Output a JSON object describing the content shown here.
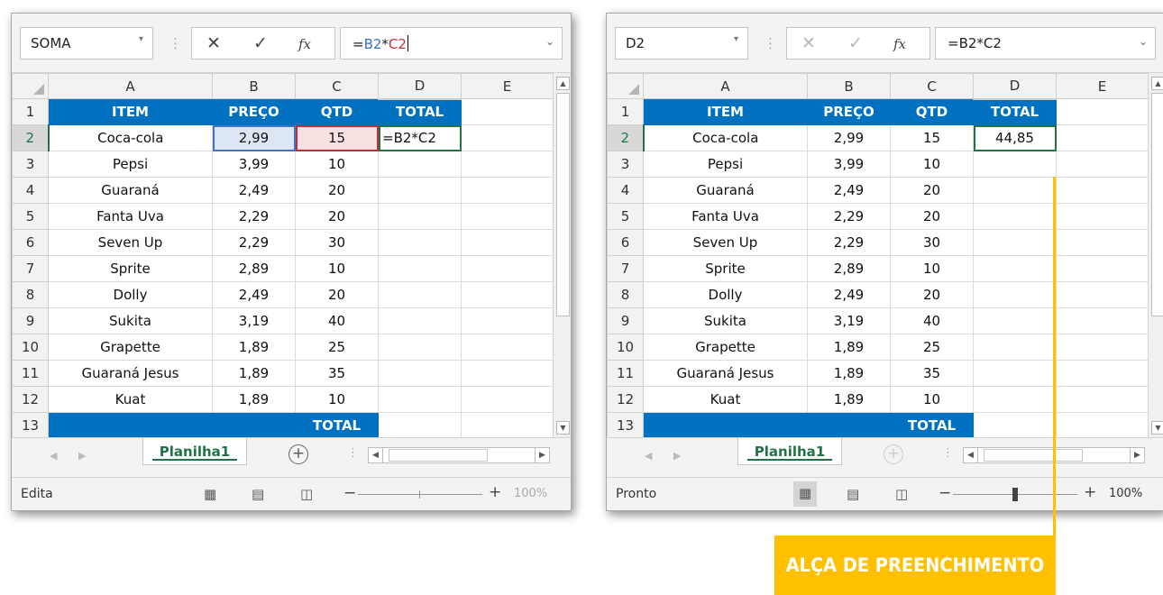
{
  "left": {
    "namebox": "SOMA",
    "formula_parts": [
      "=",
      "B2",
      "*",
      "C2"
    ],
    "sheet_tab": "Planilha1",
    "status_mode": "Edita",
    "zoom": "100%",
    "active_cell_text": "=B2*C2"
  },
  "right": {
    "namebox": "D2",
    "formula": "=B2*C2",
    "sheet_tab": "Planilha1",
    "status_mode": "Pronto",
    "zoom": "100%",
    "d2_value": "44,85"
  },
  "columns": [
    "A",
    "B",
    "C",
    "D",
    "E"
  ],
  "row_numbers": [
    "1",
    "2",
    "3",
    "4",
    "5",
    "6",
    "7",
    "8",
    "9",
    "10",
    "11",
    "12",
    "13"
  ],
  "table": {
    "headers": [
      "ITEM",
      "PREÇO",
      "QTD",
      "TOTAL"
    ],
    "rows": [
      [
        "Coca-cola",
        "2,99",
        "15"
      ],
      [
        "Pepsi",
        "3,99",
        "10"
      ],
      [
        "Guaraná",
        "2,49",
        "20"
      ],
      [
        "Fanta Uva",
        "2,29",
        "20"
      ],
      [
        "Seven Up",
        "2,29",
        "30"
      ],
      [
        "Sprite",
        "2,89",
        "10"
      ],
      [
        "Dolly",
        "2,49",
        "20"
      ],
      [
        "Sukita",
        "3,19",
        "40"
      ],
      [
        "Grapette",
        "1,89",
        "25"
      ],
      [
        "Guaraná Jesus",
        "1,89",
        "35"
      ],
      [
        "Kuat",
        "1,89",
        "10"
      ]
    ],
    "footer_label": "TOTAL"
  },
  "icons": {
    "cancel": "✕",
    "enter": "✓",
    "fx": "fx",
    "dropdown": "▾",
    "chevron": "⌄",
    "add_sheet": "+",
    "scroll_up": "▲",
    "scroll_down": "▼",
    "scroll_left": "◀",
    "scroll_right": "▶",
    "nav_prev": "◀",
    "nav_next": "▶",
    "view_normal": "▦",
    "view_page": "▤",
    "view_break": "◫",
    "zoom_minus": "−",
    "zoom_plus": "+"
  },
  "callout_label": "ALÇA DE PREENCHIMENTO",
  "colors": {
    "header_blue": "#0070c0",
    "excel_green": "#217346",
    "callout": "#ffc000",
    "ref_b": "#4472c4",
    "ref_c": "#c0303a"
  }
}
